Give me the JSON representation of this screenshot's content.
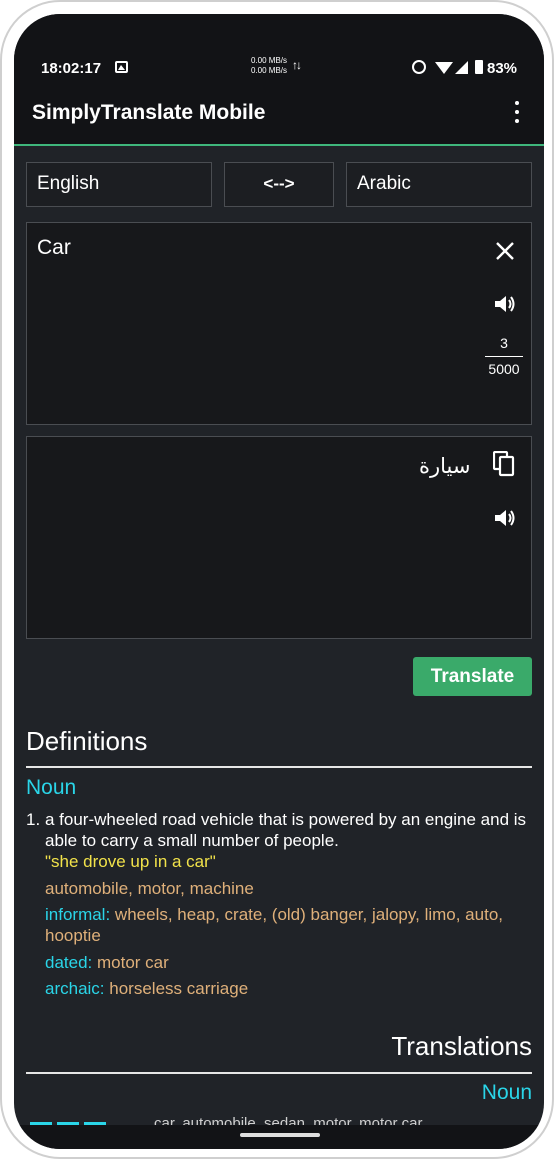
{
  "status_bar": {
    "time": "18:02:17",
    "net_up": "0.00 MB/s",
    "net_down": "0.00 MB/s",
    "battery": "83%"
  },
  "app_bar": {
    "title": "SimplyTranslate Mobile"
  },
  "languages": {
    "source": "English",
    "swap": "<-->",
    "target": "Arabic"
  },
  "input": {
    "text": "Car",
    "char_count": "3",
    "char_limit": "5000"
  },
  "output": {
    "text": "سيارة"
  },
  "translate_button": "Translate",
  "definitions": {
    "heading": "Definitions",
    "part_of_speech": "Noun",
    "items": [
      {
        "number": "1.",
        "text": "a four-wheeled road vehicle that is powered by an engine and is able to carry a small number of people.",
        "example": "\"she drove up in a car\"",
        "synonyms": "automobile, motor, machine",
        "informal_tag": "informal:",
        "informal": "wheels, heap, crate, (old) banger, jalopy, limo, auto, hooptie",
        "dated_tag": "dated:",
        "dated": "motor car",
        "archaic_tag": "archaic:",
        "archaic": "horseless carriage"
      }
    ]
  },
  "translations": {
    "heading": "Translations",
    "part_of_speech": "Noun",
    "peek_text": "car, automobile, sedan, motor, motor car"
  },
  "colors": {
    "accent": "#3aaa6a",
    "cyan": "#2ad5e8",
    "example_yellow": "#f1e24a",
    "synonym_tan": "#dfb07a",
    "background": "#202328"
  }
}
